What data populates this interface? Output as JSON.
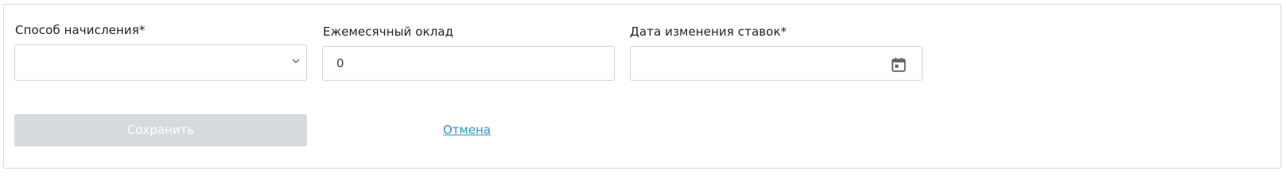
{
  "form": {
    "accrual_method": {
      "label": "Способ начисления*",
      "value": ""
    },
    "monthly_salary": {
      "label": "Ежемесячный оклад",
      "value": "0"
    },
    "rate_change_date": {
      "label": "Дата изменения ставок*",
      "value": ""
    }
  },
  "actions": {
    "save_label": "Сохранить",
    "cancel_label": "Отмена"
  },
  "icons": {
    "select_chevron": "chevron-down-icon",
    "date_picker": "calendar-icon"
  },
  "colors": {
    "border": "#cfd4d9",
    "save_disabled_bg": "#d6dadc",
    "link": "#2f95c4",
    "text": "#1f2328"
  }
}
